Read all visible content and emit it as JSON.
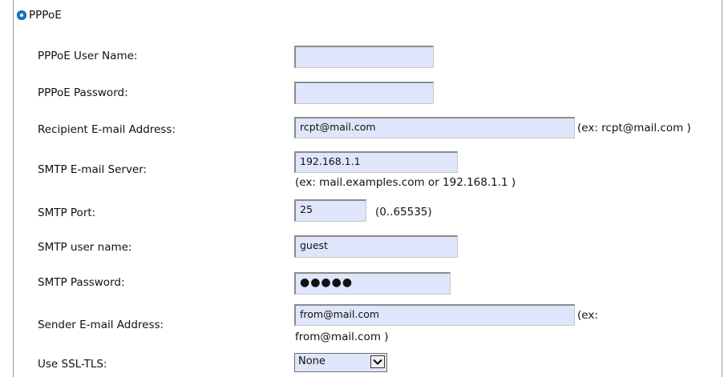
{
  "section": {
    "label": "PPPoE",
    "selected": true
  },
  "form": {
    "pppoe_user": {
      "label": "PPPoE User Name:",
      "value": ""
    },
    "pppoe_password": {
      "label": "PPPoE Password:",
      "value": ""
    },
    "recipient": {
      "label": "Recipient E-mail Address:",
      "value": "rcpt@mail.com",
      "hint": "(ex: rcpt@mail.com )"
    },
    "smtp_server": {
      "label": "SMTP E-mail Server:",
      "value": "192.168.1.1",
      "hint": "(ex: mail.examples.com or 192.168.1.1 )"
    },
    "smtp_port": {
      "label": "SMTP Port:",
      "value": "25",
      "hint": "(0..65535)"
    },
    "smtp_user": {
      "label": "SMTP user name:",
      "value": "guest"
    },
    "smtp_password": {
      "label": "SMTP Password:",
      "masked": "●●●●●"
    },
    "sender": {
      "label": "Sender E-mail Address:",
      "value": "from@mail.com",
      "hint_line1": "(ex:",
      "hint_line2": "from@mail.com )"
    },
    "ssl_tls": {
      "label": "Use SSL-TLS:",
      "selected": "None"
    }
  }
}
